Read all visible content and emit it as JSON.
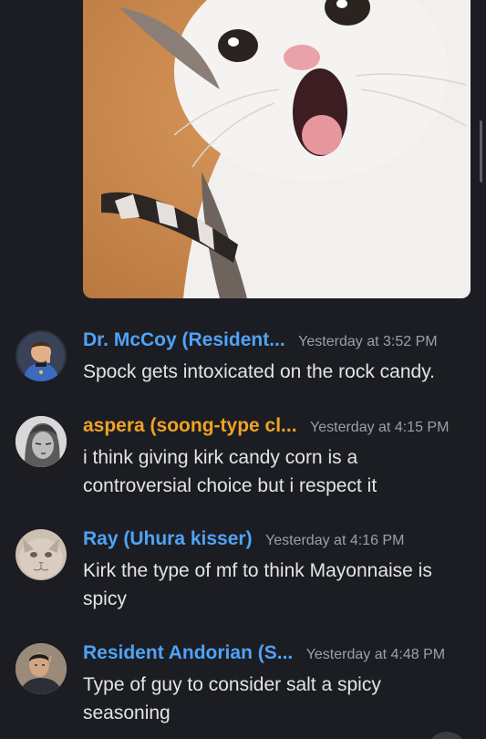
{
  "colors": {
    "background": "#1c1d22",
    "author_blue": "#4fa3f7",
    "author_orange": "#f0a324",
    "timestamp": "#9ba0a8",
    "text": "#e2e4e8"
  },
  "attachment": {
    "icon": "cat-photo"
  },
  "messages": [
    {
      "author": "Dr. McCoy (Resident...",
      "timestamp": "Yesterday at 3:52 PM",
      "content": "Spock gets intoxicated on the rock candy.",
      "avatar": "mccoy-avatar"
    },
    {
      "author": "aspera (soong-type cl...",
      "timestamp": "Yesterday at 4:15 PM",
      "content": "i think giving kirk candy corn is a controversial choice but i respect it",
      "avatar": "aspera-avatar"
    },
    {
      "author": "Ray (Uhura kisser)",
      "timestamp": "Yesterday at 4:16 PM",
      "content": "Kirk the type of mf to think Mayonnaise is spicy",
      "avatar": "ray-avatar"
    },
    {
      "author": "Resident Andorian (S...",
      "timestamp": "Yesterday at 4:48 PM",
      "content": "Type of guy to consider salt a spicy seasoning",
      "avatar": "andorian-avatar"
    }
  ]
}
